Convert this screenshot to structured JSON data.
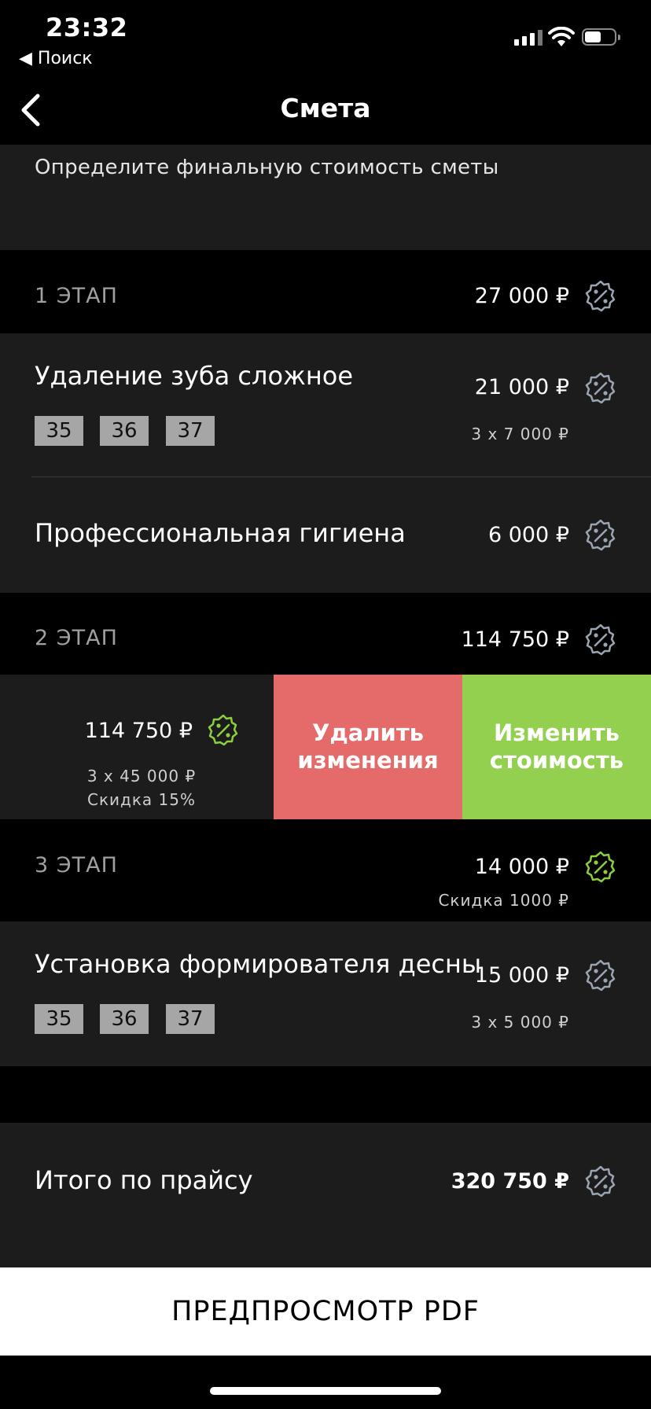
{
  "status_bar": {
    "time": "23:32",
    "back_app": "◀ Поиск"
  },
  "nav": {
    "title": "Смета"
  },
  "subtitle": "Определите финальную стоимость сметы",
  "stages": [
    {
      "label": "1 ЭТАП",
      "price": "27 000 ₽",
      "items": [
        {
          "title": "Удаление зуба сложное",
          "price": "21 000 ₽",
          "calc": "3 x 7 000 ₽",
          "teeth": [
            "35",
            "36",
            "37"
          ]
        },
        {
          "title": "Профессиональная гигиена",
          "price": "6 000 ₽"
        }
      ]
    },
    {
      "label": "2 ЭТАП",
      "price": "114 750 ₽",
      "swiped_item": {
        "price": "114 750 ₽",
        "calc": "3 x 45 000 ₽",
        "discount": "Скидка 15%"
      }
    },
    {
      "label": "3 ЭТАП",
      "price": "14 000 ₽",
      "discount": "Скидка 1000 ₽",
      "items": [
        {
          "title": "Установка формирователя десны",
          "price": "15 000 ₽",
          "calc": "3 x 5 000 ₽",
          "teeth": [
            "35",
            "36",
            "37"
          ]
        }
      ]
    }
  ],
  "actions": {
    "delete_changes": "Удалить изменения",
    "change_cost": "Изменить стоимость"
  },
  "total": {
    "label": "Итого по прайсу",
    "price": "320 750 ₽"
  },
  "pdf_button": "ПРЕДПРОСМОТР PDF",
  "colors": {
    "delete": "#e46b69",
    "change": "#93d04f",
    "icon_gray": "#9aa4b2",
    "icon_green": "#8bcf3f"
  },
  "icons": {
    "discount": "percent-badge-icon",
    "back": "chevron-left-icon"
  }
}
